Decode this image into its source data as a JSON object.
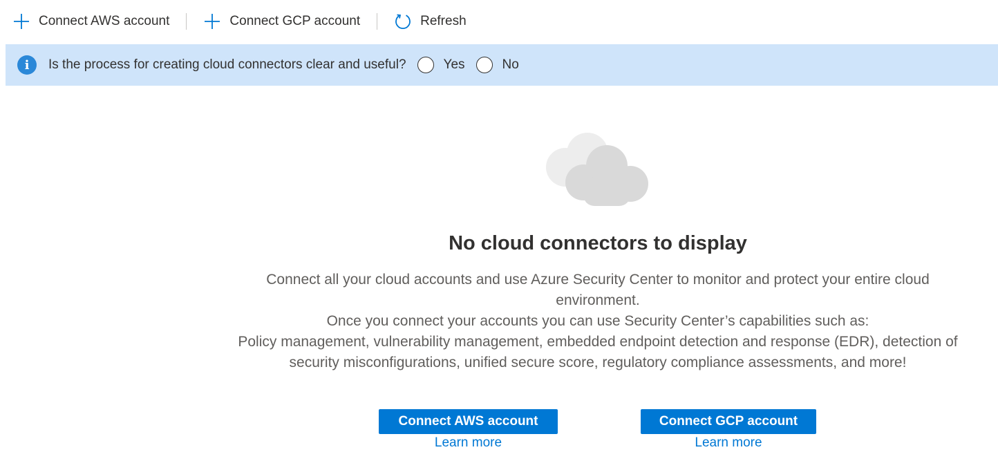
{
  "toolbar": {
    "connect_aws": "Connect AWS account",
    "connect_gcp": "Connect GCP account",
    "refresh": "Refresh"
  },
  "banner": {
    "question": "Is the process for creating cloud connectors clear and useful?",
    "options": [
      "Yes",
      "No"
    ],
    "selected": null
  },
  "empty_state": {
    "title": "No cloud connectors to display",
    "description_lines": [
      "Connect all your cloud accounts and use Azure Security Center to monitor and protect your entire cloud environment.",
      "Once you connect your accounts you can use Security Center’s capabilities such as:",
      "Policy management, vulnerability management, embedded endpoint detection and response (EDR), detection of security misconfigurations, unified secure score, regulatory compliance assessments, and more!"
    ],
    "aws_button": "Connect AWS account",
    "gcp_button": "Connect GCP account",
    "aws_learn_more": "Learn more",
    "gcp_learn_more": "Learn more"
  },
  "colors": {
    "accent": "#0078d4",
    "banner_bg": "#cfe4fa",
    "cloud_gray": "#d9d9d9"
  },
  "icons": {
    "add": "plus-icon",
    "refresh": "refresh-icon",
    "info": "info-icon",
    "empty": "cloud-icon"
  }
}
